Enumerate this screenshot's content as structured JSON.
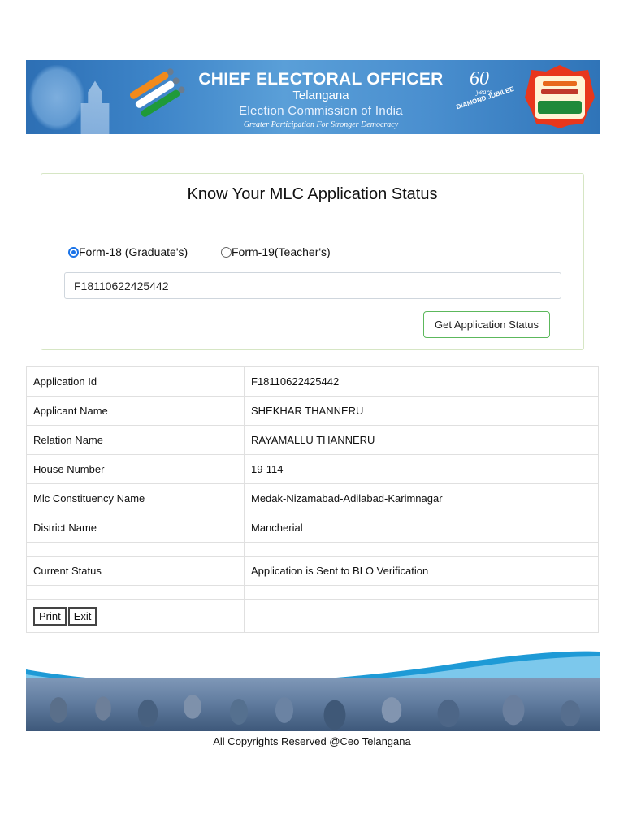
{
  "header": {
    "title": "CHIEF ELECTORAL OFFICER",
    "state": "Telangana",
    "organization": "Election Commission of India",
    "tagline": "Greater Participation For Stronger Democracy",
    "jubilee": {
      "number": "60",
      "years_label": "years",
      "caption": "DIAMOND JUBILEE"
    },
    "badge_icon": "national-voters-day-badge",
    "eci_logo_icon": "eci-tricolor-logo",
    "colors": {
      "banner": "#3d84c8"
    }
  },
  "panel": {
    "title": "Know Your MLC Application Status",
    "radio_form18": "Form-18 (Graduate's)",
    "radio_form19": "Form-19(Teacher's)",
    "selected_form": "Form-18",
    "application_input_value": "F18110622425442",
    "submit_label": "Get Application Status",
    "colors": {
      "submit_border": "#5cb85c",
      "panel_border": "#d6e6c4"
    }
  },
  "details": {
    "rows": [
      {
        "label": "Application Id",
        "value": "F18110622425442"
      },
      {
        "label": "Applicant Name",
        "value": "SHEKHAR THANNERU"
      },
      {
        "label": "Relation Name",
        "value": "RAYAMALLU THANNERU"
      },
      {
        "label": "House Number",
        "value": "19-114"
      },
      {
        "label": "Mlc Constituency Name",
        "value": "Medak-Nizamabad-Adilabad-Karimnagar"
      },
      {
        "label": "District Name",
        "value": "Mancherial"
      }
    ],
    "status": {
      "label": "Current Status",
      "value": "Application is Sent to BLO Verification"
    },
    "print_label": "Print",
    "exit_label": "Exit"
  },
  "footer": {
    "image_icon": "people-montage-banner",
    "copyright": "All Copyrights Reserved @Ceo Telangana"
  }
}
